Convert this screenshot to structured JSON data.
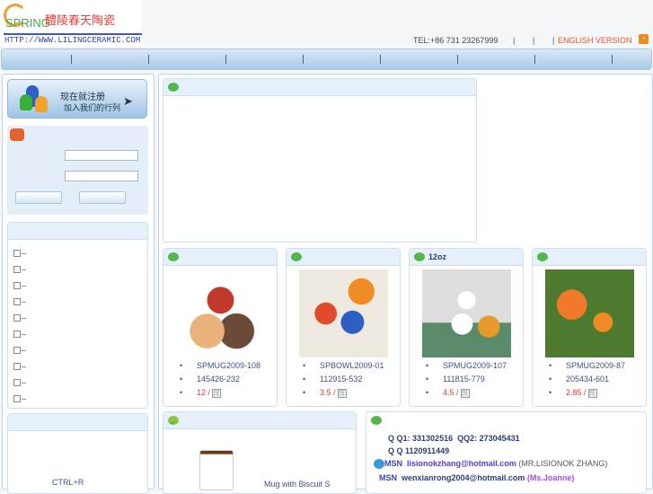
{
  "header": {
    "logo_text": "SPRING",
    "logo_cn": "醴陵春天陶瓷",
    "url": "HTTP://WWW.LILINGCERAMIC.COM",
    "tel": "TEL:+86 731 23267999",
    "separator": "|",
    "english": "ENGLISH VERSION",
    "rss_icon": "rss-icon"
  },
  "register": {
    "line1": "现在就注册",
    "line2": "加入我们的行列"
  },
  "sidebar": {
    "refresh_hint": "CTRL+R",
    "tree_count": 10
  },
  "products": [
    {
      "title": "",
      "code": "SPMUG2009-108",
      "sub": "145426-232",
      "price": "12 /",
      "colors": [
        "#c0392b",
        "#e8b27a"
      ]
    },
    {
      "title": "",
      "code": "SPBOWL2009-01",
      "sub": "112915-532",
      "price": "3.5 /",
      "colors": [
        "#f08a24",
        "#2d5fc2"
      ]
    },
    {
      "title": "12oz",
      "code": "SPMUG2009-107",
      "sub": "111815-779",
      "price": "4.5 /",
      "colors": [
        "#efe7d5",
        "#e79a2a"
      ]
    },
    {
      "title": "",
      "code": "SPMUG2009-87",
      "sub": "205434-601",
      "price": "2.85 /",
      "colors": [
        "#4d7a2e",
        "#f0792a"
      ]
    }
  ],
  "featured": {
    "label": "Mug with Biscuit S"
  },
  "contact": {
    "qq1_label": "Q Q1:",
    "qq1": "331302516",
    "qq2_label": "QQ2:",
    "qq2": "273045431",
    "qq_label": "Q Q",
    "qq": "1120911449",
    "msn_label": "MSN",
    "msn1": "lisionokzhang@hotmail.com",
    "msn1_name": "(MR.LISIONOK ZHANG)",
    "msn2": "wenxianrong2004@hotmail.com",
    "msn2_name": "(Ms.Joanne)"
  }
}
